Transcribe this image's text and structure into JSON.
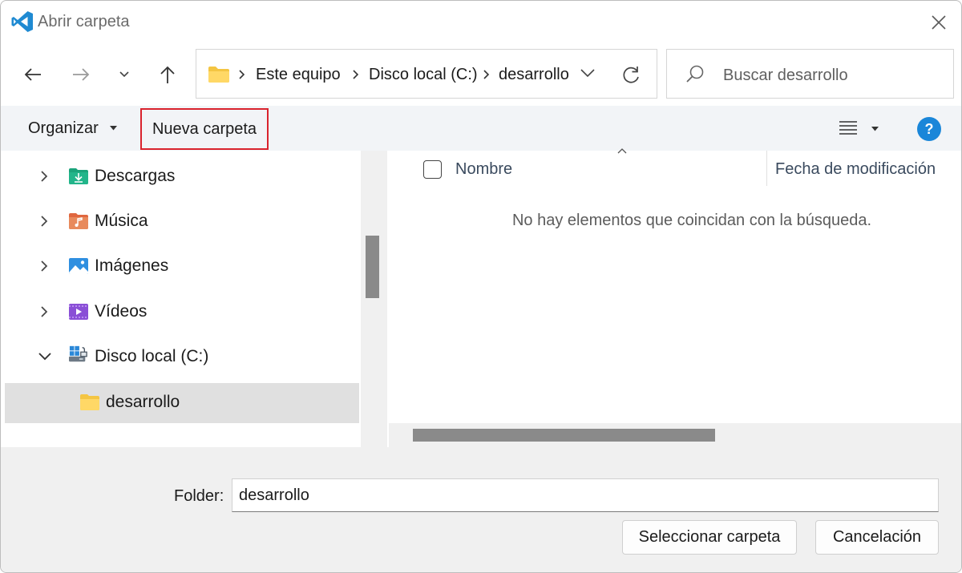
{
  "window": {
    "title": "Abrir carpeta",
    "app_icon": "vscode-icon",
    "close_icon": "close-icon"
  },
  "nav": {
    "back_icon": "arrow-left-icon",
    "forward_icon": "arrow-right-icon",
    "recent_icon": "chevron-down-icon",
    "up_icon": "arrow-up-icon"
  },
  "address": {
    "breadcrumbs": [
      "Este equipo",
      "Disco local (C:)",
      "desarrollo"
    ],
    "refresh_icon": "refresh-icon"
  },
  "search": {
    "placeholder": "Buscar desarrollo"
  },
  "toolbar": {
    "organize_label": "Organizar",
    "new_folder_label": "Nueva carpeta",
    "help_label": "?",
    "highlight_color": "#d9232d"
  },
  "tree": {
    "items": [
      {
        "label": "Descargas",
        "icon": "downloads-folder-icon",
        "expanded": false
      },
      {
        "label": "Música",
        "icon": "music-folder-icon",
        "expanded": false
      },
      {
        "label": "Imágenes",
        "icon": "pictures-folder-icon",
        "expanded": false
      },
      {
        "label": "Vídeos",
        "icon": "videos-folder-icon",
        "expanded": false
      },
      {
        "label": "Disco local (C:)",
        "icon": "local-disk-icon",
        "expanded": true
      },
      {
        "label": "desarrollo",
        "icon": "folder-icon",
        "selected": true
      }
    ]
  },
  "content": {
    "columns": [
      "Nombre",
      "Fecha de modificación"
    ],
    "empty_message": "No hay elementos que coincidan con la búsqueda."
  },
  "footer": {
    "folder_label": "Folder:",
    "folder_value": "desarrollo",
    "select_button": "Seleccionar carpeta",
    "cancel_button": "Cancelación"
  }
}
